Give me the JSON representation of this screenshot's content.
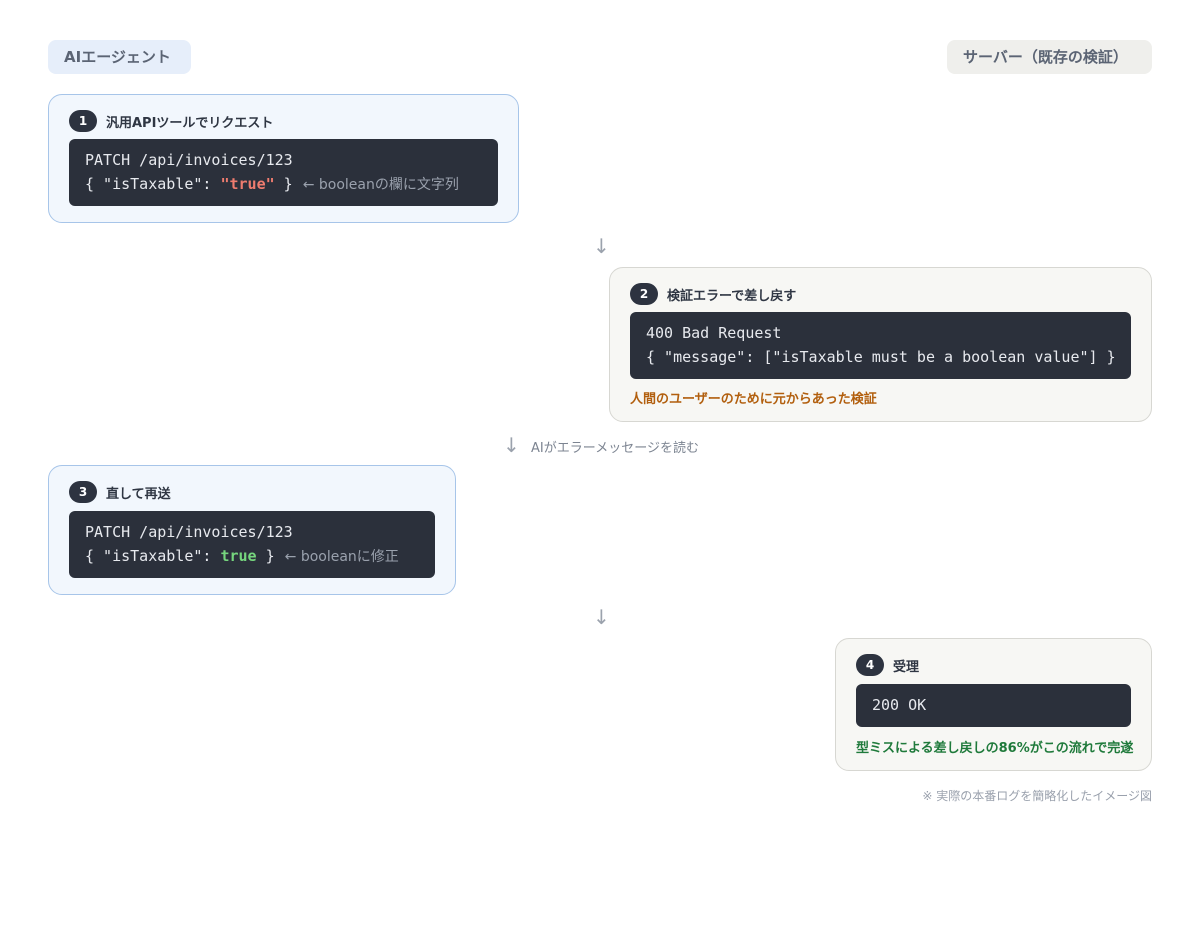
{
  "lanes": {
    "agent": "AIエージェント",
    "server": "サーバー（既存の検証）"
  },
  "steps": [
    {
      "number": "1",
      "title": "汎用APIツールでリクエスト",
      "code_line1": "PATCH /api/invoices/123",
      "code_line2_prefix": "{ \"isTaxable\": ",
      "code_line2_value": "\"true\"",
      "code_line2_suffix": " }",
      "note": "← booleanの欄に文字列"
    },
    {
      "number": "2",
      "title": "検証エラーで差し戻す",
      "code_line1": "400 Bad Request",
      "code_line2": "{ \"message\": [\"isTaxable must be a boolean value\"] }",
      "remark": "人間のユーザーのために元からあった検証"
    },
    {
      "number": "3",
      "title": "直して再送",
      "code_line1": "PATCH /api/invoices/123",
      "code_line2_prefix": "{ \"isTaxable\": ",
      "code_line2_value": "true",
      "code_line2_suffix": " }",
      "note": "← booleanに修正"
    },
    {
      "number": "4",
      "title": "受理",
      "code_line1": "200 OK",
      "remark": "型ミスによる差し戻しの86%がこの流れで完遂"
    }
  ],
  "arrows": {
    "symbol": "↓",
    "a2_to_3_note": "AIがエラーメッセージを読む"
  },
  "footnote": "※ 実際の本番ログを簡略化したイメージ図",
  "colors": {
    "agent_bg": "#f2f7fd",
    "agent_border": "#a7c5e9",
    "server_bg": "#f7f7f4",
    "server_border": "#d7d7d2",
    "code_bg": "#2b303b",
    "bad_value": "#ef7c6f",
    "good_value": "#76d67e",
    "remark_orange": "#b25f0e",
    "remark_green": "#1f7a3b"
  }
}
